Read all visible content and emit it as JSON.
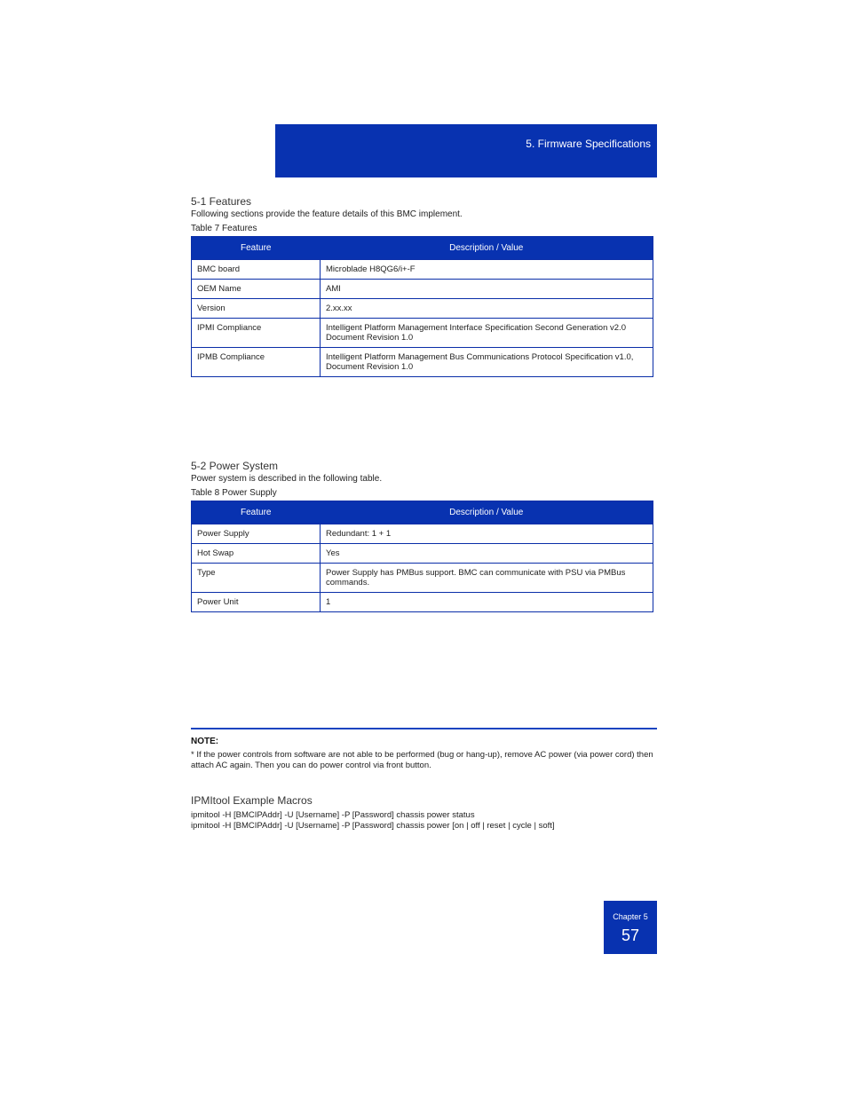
{
  "title_line": "5. Firmware Specifications",
  "page_marker": {
    "chapter": "Chapter  5",
    "page": "57"
  },
  "sec1": {
    "id": "5-1 Features",
    "intro": "Following sections provide the feature details of this BMC implement.",
    "table": {
      "caption": "Table 7 Features",
      "head": [
        "Feature",
        "Description / Value"
      ],
      "rows": [
        [
          "BMC board",
          "Microblade H8QG6/i+-F"
        ],
        [
          "OEM Name",
          "AMI"
        ],
        [
          "Version",
          "2.xx.xx"
        ],
        [
          "IPMI Compliance",
          "Intelligent Platform Management Interface Specification Second Generation v2.0 Document Revision 1.0"
        ],
        [
          "IPMB Compliance",
          "Intelligent Platform Management Bus Communications Protocol Specification v1.0, Document Revision 1.0"
        ]
      ]
    }
  },
  "sec2": {
    "id": "5-2 Power System",
    "intro": "Power system is described in the following table.",
    "table": {
      "caption": "Table 8 Power Supply",
      "head": [
        "Feature",
        "Description / Value"
      ],
      "rows": [
        [
          "Power Supply",
          "Redundant: 1 + 1"
        ],
        [
          "Hot Swap",
          "Yes"
        ],
        [
          "Type",
          "Power Supply has PMBus support. BMC can communicate with PSU via PMBus commands."
        ],
        [
          "Power Unit",
          "1"
        ]
      ]
    }
  },
  "note": {
    "label": "NOTE:",
    "text": "* If the power controls from software are not able to be performed (bug or hang-up), remove AC power (via power cord) then attach AC again. Then you can do power control via front button."
  },
  "macro": {
    "title": "IPMItool Example Macros",
    "line1": "ipmitool -H [BMCIPAddr] -U [Username] -P [Password] chassis power status",
    "line2": "ipmitool -H [BMCIPAddr] -U [Username] -P [Password] chassis power [on | off | reset | cycle | soft]"
  }
}
